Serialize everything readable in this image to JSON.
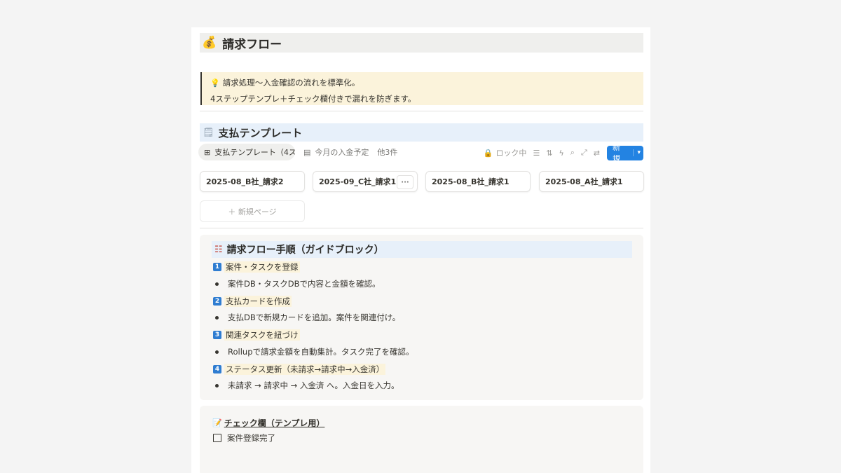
{
  "page": {
    "icon": "money-bag-icon",
    "title": "請求フロー"
  },
  "callout": {
    "icon": "lightbulb-icon",
    "line1": "請求処理〜入金確認の流れを標準化。",
    "line2": "4ステップテンプレ＋チェック欄付きで漏れを防ぎます。"
  },
  "database": {
    "icon": "receipt-icon",
    "title": "支払テンプレート",
    "views": [
      {
        "label": "支払テンプレート（4ス...",
        "icon": "gallery-icon",
        "active": true
      },
      {
        "label": "今月の入金予定",
        "icon": "table-icon",
        "active": false
      }
    ],
    "more_views": "他3件",
    "toolbar": {
      "lock_label": "ロック中",
      "new_label": "新規"
    },
    "cards": [
      {
        "title": "2025-08_B社_請求2"
      },
      {
        "title": "2025-09_C社_請求1"
      },
      {
        "title": "2025-08_B社_請求1"
      },
      {
        "title": "2025-08_A社_請求1"
      }
    ],
    "more_button": "···",
    "new_page_label": "＋ 新規ページ"
  },
  "guide": {
    "icon": "ladder-icon",
    "title": "請求フロー手順（ガイドブロック）",
    "steps": [
      {
        "num": "1",
        "title": "案件・タスクを登録",
        "detail": "案件DB・タスクDBで内容と金額を確認。"
      },
      {
        "num": "2",
        "title": "支払カードを作成",
        "detail": "支払DBで新規カードを追加。案件を関連付け。"
      },
      {
        "num": "3",
        "title": "関連タスクを紐づけ",
        "detail": "Rollupで請求金額を自動集計。タスク完了を確認。"
      },
      {
        "num": "4",
        "title": "ステータス更新（未請求→請求中→入金済）",
        "detail": "未請求 → 請求中 → 入金済 へ。入金日を入力。"
      }
    ]
  },
  "checklist": {
    "icon": "memo-icon",
    "title": "チェック欄（テンプレ用）",
    "items": [
      {
        "label": "案件登録完了",
        "checked": false
      }
    ]
  }
}
